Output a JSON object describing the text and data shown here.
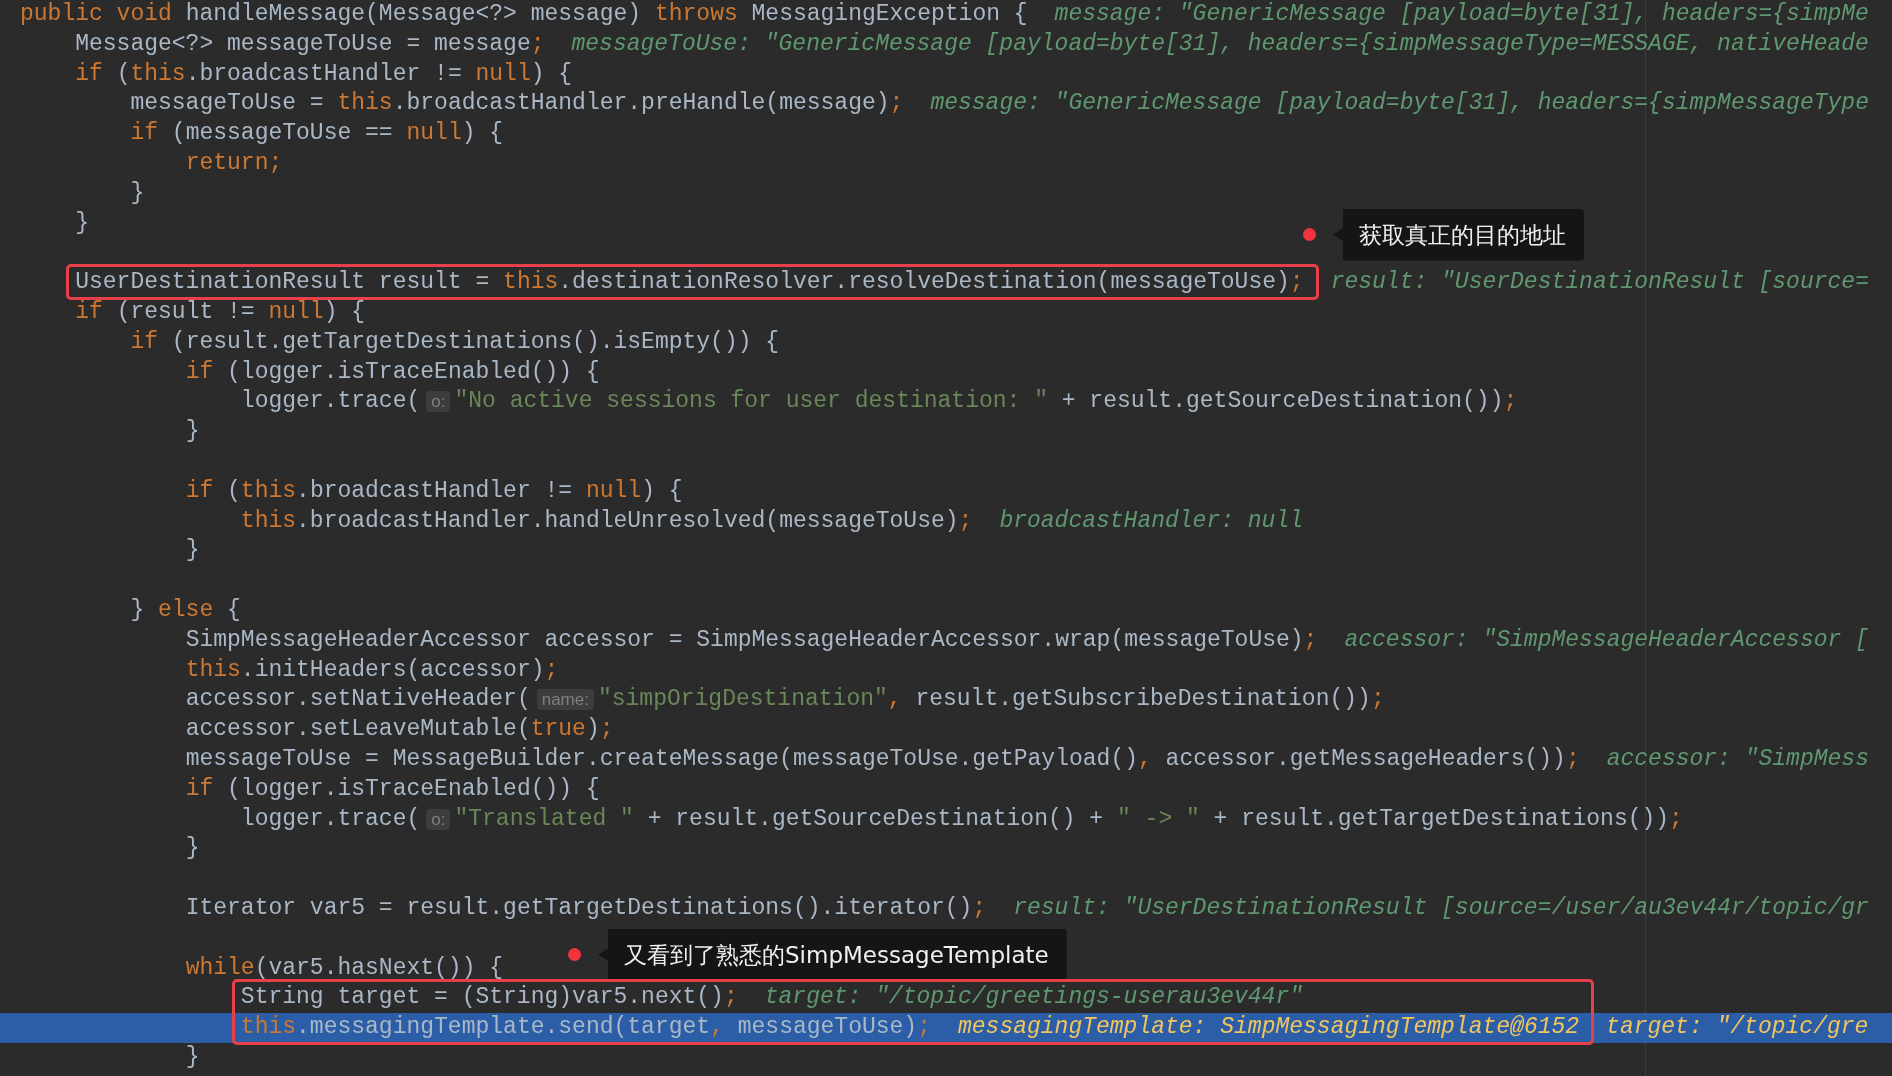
{
  "editor": {
    "lines": [
      {
        "kind": "code",
        "code": [
          {
            "kind": "kw",
            "text": "public void "
          },
          {
            "kind": "p",
            "text": "handleMessage(Message<?> message) "
          },
          {
            "kind": "kw",
            "text": "throws "
          },
          {
            "kind": "p",
            "text": "MessagingException {"
          }
        ],
        "hints": [
          "message: \"GenericMessage [payload=byte[31], headers={simpMe"
        ],
        "children": [
          {
            "kind": "code",
            "code": [
              {
                "kind": "p",
                "text": "Message<?> messageToUse = message"
              },
              {
                "kind": "kw",
                "text": ";"
              }
            ],
            "hints": [
              "messageToUse: \"GenericMessage [payload=byte[31], headers={simpMessageType=MESSAGE, nativeHeade"
            ]
          },
          {
            "kind": "code",
            "code": [
              {
                "kind": "kw",
                "text": "if "
              },
              {
                "kind": "p",
                "text": "("
              },
              {
                "kind": "kw",
                "text": "this"
              },
              {
                "kind": "p",
                "text": ".broadcastHandler != "
              },
              {
                "kind": "kw",
                "text": "null"
              },
              {
                "kind": "p",
                "text": ") {"
              }
            ],
            "children": [
              {
                "kind": "code",
                "code": [
                  {
                    "kind": "p",
                    "text": "messageToUse = "
                  },
                  {
                    "kind": "kw",
                    "text": "this"
                  },
                  {
                    "kind": "p",
                    "text": ".broadcastHandler.preHandle(message)"
                  },
                  {
                    "kind": "kw",
                    "text": ";"
                  }
                ],
                "hints": [
                  "message: \"GenericMessage [payload=byte[31], headers={simpMessageType"
                ]
              },
              {
                "kind": "code",
                "code": [
                  {
                    "kind": "kw",
                    "text": "if "
                  },
                  {
                    "kind": "p",
                    "text": "(messageToUse == "
                  },
                  {
                    "kind": "kw",
                    "text": "null"
                  },
                  {
                    "kind": "p",
                    "text": ") {"
                  }
                ],
                "children": [
                  {
                    "kind": "code",
                    "code": [
                      {
                        "kind": "kw",
                        "text": "return;"
                      }
                    ]
                  }
                ]
              },
              {
                "kind": "code",
                "code": [
                  {
                    "kind": "p",
                    "text": "}"
                  }
                ]
              }
            ]
          },
          {
            "kind": "code",
            "code": [
              {
                "kind": "p",
                "text": "}"
              }
            ],
            "callout": "获取真正的目的地址"
          },
          {
            "kind": "blank"
          },
          {
            "kind": "code",
            "framed": true,
            "code": [
              {
                "kind": "p",
                "text": "UserDestinationResult result = "
              },
              {
                "kind": "kw",
                "text": "this"
              },
              {
                "kind": "p",
                "text": ".destinationResolver.resolveDestination(messageToUse)"
              },
              {
                "kind": "kw",
                "text": ";"
              }
            ],
            "hints": [
              "result: \"UserDestinationResult [source="
            ]
          },
          {
            "kind": "code",
            "code": [
              {
                "kind": "kw",
                "text": "if "
              },
              {
                "kind": "p",
                "text": "(result != "
              },
              {
                "kind": "kw",
                "text": "null"
              },
              {
                "kind": "p",
                "text": ") {"
              }
            ],
            "children": [
              {
                "kind": "code",
                "code": [
                  {
                    "kind": "kw",
                    "text": "if "
                  },
                  {
                    "kind": "p",
                    "text": "(result.getTargetDestinations().isEmpty()) {"
                  }
                ],
                "children": [
                  {
                    "kind": "code",
                    "code": [
                      {
                        "kind": "kw",
                        "text": "if "
                      },
                      {
                        "kind": "p",
                        "text": "(logger.isTraceEnabled()) {"
                      }
                    ],
                    "children": [
                      {
                        "kind": "code",
                        "code": [
                          {
                            "kind": "p",
                            "text": "logger.trace("
                          },
                          {
                            "kind": "param",
                            "text": "o:"
                          },
                          {
                            "kind": "str",
                            "text": "\"No active sessions for user destination: \""
                          },
                          {
                            "kind": "p",
                            "text": " + result.getSourceDestination())"
                          },
                          {
                            "kind": "kw",
                            "text": ";"
                          }
                        ]
                      }
                    ]
                  },
                  {
                    "kind": "code",
                    "code": [
                      {
                        "kind": "p",
                        "text": "}"
                      }
                    ]
                  },
                  {
                    "kind": "blank"
                  },
                  {
                    "kind": "code",
                    "code": [
                      {
                        "kind": "kw",
                        "text": "if "
                      },
                      {
                        "kind": "p",
                        "text": "("
                      },
                      {
                        "kind": "kw",
                        "text": "this"
                      },
                      {
                        "kind": "p",
                        "text": ".broadcastHandler != "
                      },
                      {
                        "kind": "kw",
                        "text": "null"
                      },
                      {
                        "kind": "p",
                        "text": ") {"
                      }
                    ],
                    "children": [
                      {
                        "kind": "code",
                        "code": [
                          {
                            "kind": "kw",
                            "text": "this"
                          },
                          {
                            "kind": "p",
                            "text": ".broadcastHandler.handleUnresolved(messageToUse)"
                          },
                          {
                            "kind": "kw",
                            "text": ";"
                          }
                        ],
                        "hints": [
                          "broadcastHandler: null"
                        ]
                      }
                    ]
                  },
                  {
                    "kind": "code",
                    "code": [
                      {
                        "kind": "p",
                        "text": "}"
                      }
                    ]
                  },
                  {
                    "kind": "blank"
                  }
                ]
              },
              {
                "kind": "code",
                "code": [
                  {
                    "kind": "p",
                    "text": "} "
                  },
                  {
                    "kind": "kw",
                    "text": "else "
                  },
                  {
                    "kind": "p",
                    "text": "{"
                  }
                ],
                "children": [
                  {
                    "kind": "code",
                    "code": [
                      {
                        "kind": "p",
                        "text": "SimpMessageHeaderAccessor accessor = SimpMessageHeaderAccessor.wrap(messageToUse)"
                      },
                      {
                        "kind": "kw",
                        "text": ";"
                      }
                    ],
                    "hints": [
                      "accessor: \"SimpMessageHeaderAccessor ["
                    ]
                  },
                  {
                    "kind": "code",
                    "code": [
                      {
                        "kind": "kw",
                        "text": "this"
                      },
                      {
                        "kind": "p",
                        "text": ".initHeaders(accessor)"
                      },
                      {
                        "kind": "kw",
                        "text": ";"
                      }
                    ]
                  },
                  {
                    "kind": "code",
                    "code": [
                      {
                        "kind": "p",
                        "text": "accessor.setNativeHeader("
                      },
                      {
                        "kind": "param",
                        "text": "name:"
                      },
                      {
                        "kind": "str",
                        "text": "\"simpOrigDestination\""
                      },
                      {
                        "kind": "kw",
                        "text": ","
                      },
                      {
                        "kind": "p",
                        "text": " result.getSubscribeDestination())"
                      },
                      {
                        "kind": "kw",
                        "text": ";"
                      }
                    ]
                  },
                  {
                    "kind": "code",
                    "code": [
                      {
                        "kind": "p",
                        "text": "accessor.setLeaveMutable("
                      },
                      {
                        "kind": "kw",
                        "text": "true"
                      },
                      {
                        "kind": "p",
                        "text": ")"
                      },
                      {
                        "kind": "kw",
                        "text": ";"
                      }
                    ]
                  },
                  {
                    "kind": "code",
                    "code": [
                      {
                        "kind": "p",
                        "text": "messageToUse = MessageBuilder.createMessage(messageToUse.getPayload()"
                      },
                      {
                        "kind": "kw",
                        "text": ","
                      },
                      {
                        "kind": "p",
                        "text": " accessor.getMessageHeaders())"
                      },
                      {
                        "kind": "kw",
                        "text": ";"
                      }
                    ],
                    "hints": [
                      "accessor: \"SimpMess"
                    ]
                  },
                  {
                    "kind": "code",
                    "code": [
                      {
                        "kind": "kw",
                        "text": "if "
                      },
                      {
                        "kind": "p",
                        "text": "(logger.isTraceEnabled()) {"
                      }
                    ],
                    "children": [
                      {
                        "kind": "code",
                        "code": [
                          {
                            "kind": "p",
                            "text": "logger.trace("
                          },
                          {
                            "kind": "param",
                            "text": "o:"
                          },
                          {
                            "kind": "str",
                            "text": "\"Translated \""
                          },
                          {
                            "kind": "p",
                            "text": " + result.getSourceDestination() + "
                          },
                          {
                            "kind": "str",
                            "text": "\" -> \""
                          },
                          {
                            "kind": "p",
                            "text": " + result.getTargetDestinations())"
                          },
                          {
                            "kind": "kw",
                            "text": ";"
                          }
                        ]
                      }
                    ]
                  },
                  {
                    "kind": "code",
                    "code": [
                      {
                        "kind": "p",
                        "text": "}"
                      }
                    ]
                  },
                  {
                    "kind": "blank"
                  },
                  {
                    "kind": "code",
                    "code": [
                      {
                        "kind": "p",
                        "text": "Iterator var5 = result.getTargetDestinations().iterator()"
                      },
                      {
                        "kind": "kw",
                        "text": ";"
                      }
                    ],
                    "hints": [
                      "result: \"UserDestinationResult [source=/user/au3ev44r/topic/gr"
                    ]
                  },
                  {
                    "kind": "blank",
                    "callout": "又看到了熟悉的SimpMessageTemplate"
                  },
                  {
                    "kind": "code",
                    "code": [
                      {
                        "kind": "kw",
                        "text": "while"
                      },
                      {
                        "kind": "p",
                        "text": "(var5.hasNext()) {"
                      }
                    ],
                    "children": [
                      {
                        "kind": "code",
                        "framed": true,
                        "code": [
                          {
                            "kind": "p",
                            "text": "String target = (String)var5.next()"
                          },
                          {
                            "kind": "kw",
                            "text": ";"
                          }
                        ],
                        "hints": [
                          "target: \"/topic/greetings-userau3ev44r\""
                        ]
                      },
                      {
                        "kind": "code",
                        "framed": true,
                        "current": true,
                        "code": [
                          {
                            "kind": "kw",
                            "text": "this"
                          },
                          {
                            "kind": "p",
                            "text": ".messagingTemplate.send(target"
                          },
                          {
                            "kind": "kw",
                            "text": ","
                          },
                          {
                            "kind": "p",
                            "text": " messageToUse)"
                          },
                          {
                            "kind": "kw",
                            "text": ";"
                          }
                        ],
                        "hints": [
                          "messagingTemplate: SimpMessagingTemplate@6152",
                          "target: \"/topic/gre"
                        ]
                      }
                    ]
                  },
                  {
                    "kind": "code",
                    "code": [
                      {
                        "kind": "p",
                        "text": "}"
                      }
                    ]
                  }
                ]
              }
            ]
          }
        ]
      }
    ]
  }
}
